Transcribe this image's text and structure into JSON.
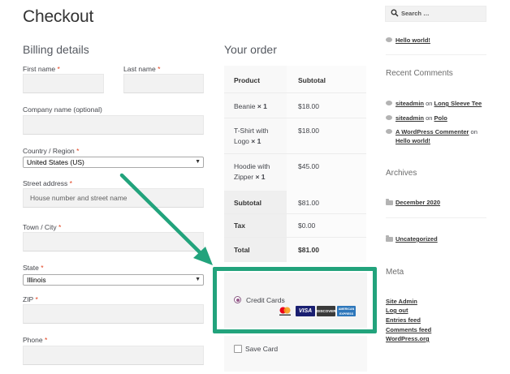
{
  "page": {
    "title": "Checkout"
  },
  "billing": {
    "title": "Billing details",
    "required_marker": "*",
    "first_name_label": "First name",
    "last_name_label": "Last name",
    "company_label": "Company name (optional)",
    "country_label": "Country / Region",
    "country_value": "United States (US)",
    "street_label": "Street address",
    "street_placeholder": "House number and street name",
    "city_label": "Town / City",
    "state_label": "State",
    "state_value": "Illinois",
    "zip_label": "ZIP",
    "phone_label": "Phone"
  },
  "order": {
    "title": "Your order",
    "col_product": "Product",
    "col_subtotal": "Subtotal",
    "items": [
      {
        "name": "Beanie",
        "qty": "× 1",
        "price": "$18.00"
      },
      {
        "name": "T-Shirt with Logo",
        "qty": "× 1",
        "price": "$18.00"
      },
      {
        "name": "Hoodie with Zipper",
        "qty": "× 1",
        "price": "$45.00"
      }
    ],
    "subtotal_label": "Subtotal",
    "subtotal_value": "$81.00",
    "tax_label": "Tax",
    "tax_value": "$0.00",
    "total_label": "Total",
    "total_value": "$81.00"
  },
  "payment": {
    "method_label": "Credit Cards",
    "cards": [
      "mastercard",
      "VISA",
      "DISCOVER",
      "AMERICAN EXPRESS"
    ],
    "save_label": "Save Card"
  },
  "sidebar": {
    "search_placeholder": "Search …",
    "posts": [
      "Hello world!"
    ],
    "recent_comments_title": "Recent Comments",
    "comments": [
      {
        "author": "siteadmin",
        "on": "on",
        "post": "Long Sleeve Tee"
      },
      {
        "author": "siteadmin",
        "on": "on",
        "post": "Polo"
      },
      {
        "author": "A WordPress Commenter",
        "on": "on",
        "post": "Hello world!"
      }
    ],
    "archives_title": "Archives",
    "archives": [
      "December 2020"
    ],
    "categories": [
      "Uncategorized"
    ],
    "meta_title": "Meta",
    "meta_links": [
      "Site Admin",
      "Log out",
      "Entries feed",
      "Comments feed",
      "WordPress.org"
    ]
  },
  "colors": {
    "highlight": "#22a37c",
    "required": "#e2401c",
    "radio": "#96588a"
  }
}
